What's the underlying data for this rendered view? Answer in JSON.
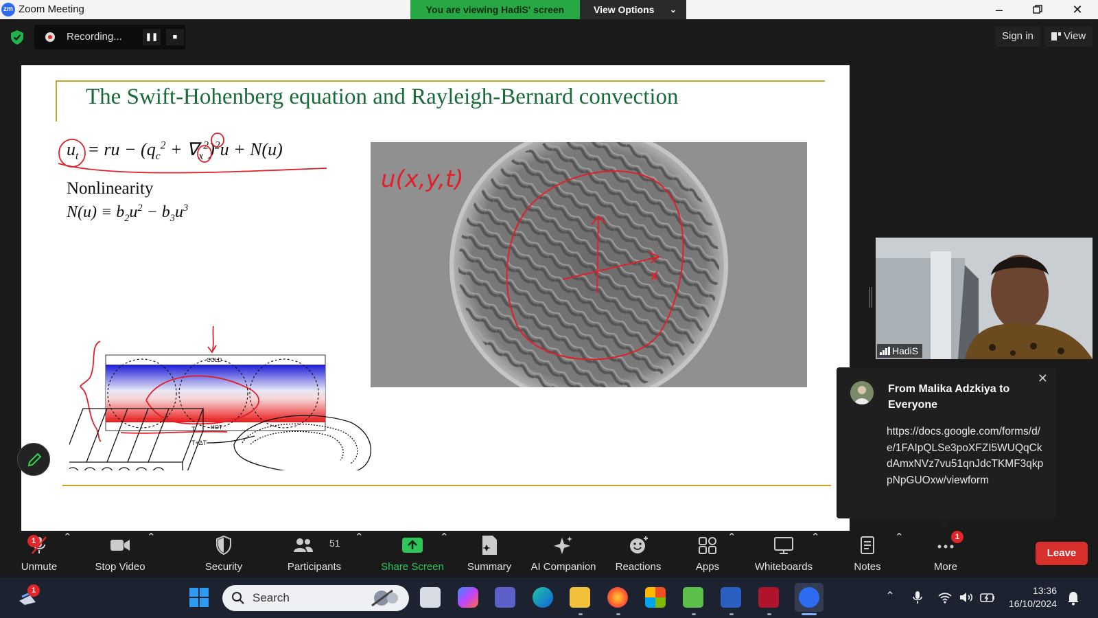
{
  "window": {
    "app_title": "Zoom Meeting",
    "app_logo_text": "zm",
    "viewing_banner": "You are viewing HadiS' screen",
    "view_options": "View Options"
  },
  "topbar": {
    "recording_label": "Recording...",
    "sign_in": "Sign in",
    "view": "View"
  },
  "slide": {
    "title": "The Swift-Hohenberg equation and Rayleigh-Bernard convection",
    "equation_lhs": "u",
    "equation_lhs_sub": "t",
    "equation_rhs": "= ru − (q",
    "nonlinearity_label": "Nonlinearity",
    "nonlinear_eq": "N(u)  ≡  b",
    "diagram_cold": "COLD",
    "diagram_hot": "HOT",
    "diagram_t": "T",
    "diagram_tdt": "T+ΔT",
    "annotation": "u(x,y,t)",
    "axis_x": "x"
  },
  "video": {
    "participant_name": "HadiS"
  },
  "chat": {
    "from": "From Malika Adzkiya to Everyone",
    "message": "https://docs.google.com/forms/d/e/1FAIpQLSe3poXFZI5WUQqCkdAmxNVz7vu51qnJdcTKMF3qkppNpGUOxw/viewform"
  },
  "toolbar": {
    "unmute": "Unmute",
    "unmute_badge": "1",
    "stop_video": "Stop Video",
    "security": "Security",
    "participants": "Participants",
    "participants_count": "51",
    "share_screen": "Share Screen",
    "summary": "Summary",
    "ai_companion": "AI Companion",
    "reactions": "Reactions",
    "apps": "Apps",
    "whiteboards": "Whiteboards",
    "notes": "Notes",
    "more": "More",
    "more_badge": "1",
    "leave": "Leave"
  },
  "taskbar": {
    "search_placeholder": "Search",
    "notif_badge": "1",
    "time": "13:36",
    "date": "16/10/2024"
  },
  "colors": {
    "zoom_blue": "#2d6cf0",
    "share_green": "#28a745",
    "leave_red": "#d9302c",
    "slide_title_green": "#176b37",
    "slide_rule_gold": "#c9a227",
    "annotation_red": "#e0202a"
  }
}
